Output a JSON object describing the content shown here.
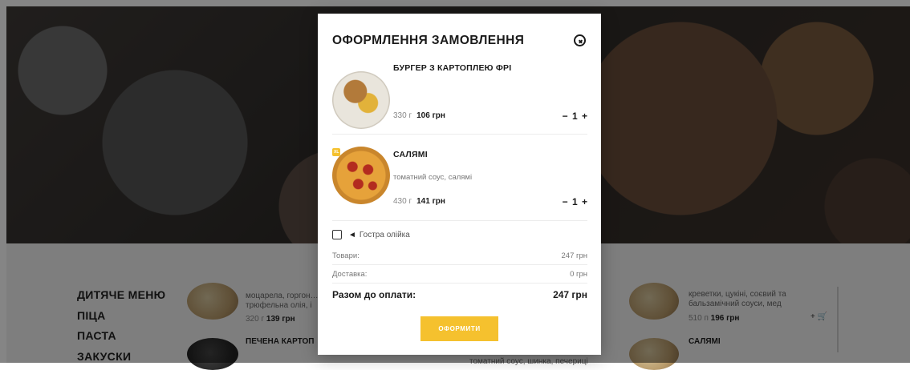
{
  "modal": {
    "title": "ОФОРМЛЕННЯ ЗАМОВЛЕННЯ",
    "items": [
      {
        "name": "БУРГЕР З КАРТОПЛЕЮ ФРІ",
        "description": "",
        "weight": "330 г",
        "price": "106 грн",
        "qty": "1",
        "minus": "−",
        "plus": "+"
      },
      {
        "name": "САЛЯМІ",
        "badge": "XL",
        "description": "томатний соус, салямі",
        "weight": "430 г",
        "price": "141 грн",
        "qty": "1",
        "minus": "−",
        "plus": "+"
      }
    ],
    "option_label": "Гостра олійка",
    "summary": {
      "goods_label": "Товари:",
      "goods_value": "247 грн",
      "delivery_label": "Доставка:",
      "delivery_value": "0 грн",
      "total_label": "Разом до оплати:",
      "total_value": "247 грн"
    },
    "checkout_label": "ОФОРМИТИ"
  },
  "background": {
    "menu": [
      "ДИТЯЧЕ МЕНЮ",
      "ПІЦА",
      "ПАСТА",
      "ЗАКУСКИ"
    ],
    "cards": [
      {
        "desc": "моцарела, горгон… трюфельна олія, і",
        "weight": "320 г",
        "price": "139 грн"
      },
      {
        "title": "ПЕЧЕНА КАРТОП"
      },
      {
        "desc": "креветки, цукіні, соєвий та бальзамічний соуси, мед",
        "weight": "510 п",
        "price": "196 грн"
      },
      {
        "title": "САЛЯМІ"
      },
      {
        "desc": "томатний соус, шинка, печериці"
      }
    ]
  }
}
